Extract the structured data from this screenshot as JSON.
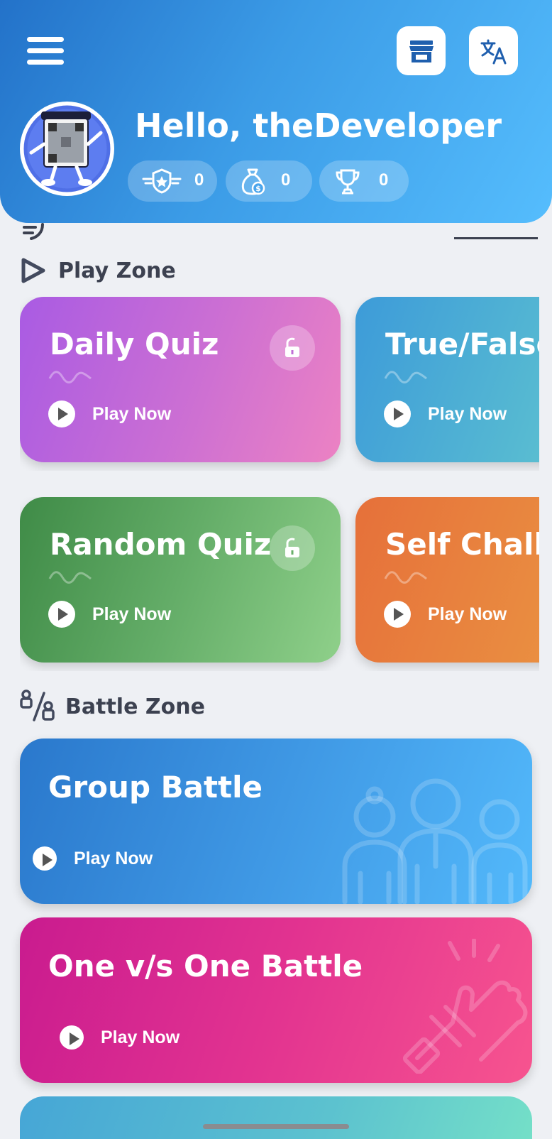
{
  "header": {
    "greeting": "Hello, theDeveloper",
    "stats": [
      {
        "icon": "rank-badge-icon",
        "value": "0"
      },
      {
        "icon": "coins-bag-icon",
        "value": "0"
      },
      {
        "icon": "trophy-icon",
        "value": "0"
      }
    ],
    "gradient": [
      "#2372c9",
      "#55bdfd"
    ]
  },
  "play_zone": {
    "title": "Play Zone",
    "rows": [
      [
        {
          "title": "Daily Quiz",
          "play": "Play Now",
          "locked_icon": "unlock-icon",
          "colors": [
            "#a95be3",
            "#ec82c3"
          ]
        },
        {
          "title": "True/False",
          "play": "Play Now",
          "colors": [
            "#3d9bd9",
            "#6dd0cd"
          ]
        }
      ],
      [
        {
          "title": "Random Quiz",
          "play": "Play Now",
          "locked_icon": "unlock-icon",
          "colors": [
            "#3f8b47",
            "#8fd08a"
          ]
        },
        {
          "title": "Self Challe",
          "play": "Play Now",
          "colors": [
            "#e6703a",
            "#ec9f45"
          ]
        }
      ]
    ]
  },
  "battle_zone": {
    "title": "Battle Zone",
    "cards": [
      {
        "title": "Group Battle",
        "play": "Play Now",
        "colors": [
          "#2a78cc",
          "#53b9fb"
        ]
      },
      {
        "title": "One v/s One Battle",
        "play": "Play Now",
        "colors": [
          "#c91b8f",
          "#f7548f"
        ]
      }
    ]
  }
}
